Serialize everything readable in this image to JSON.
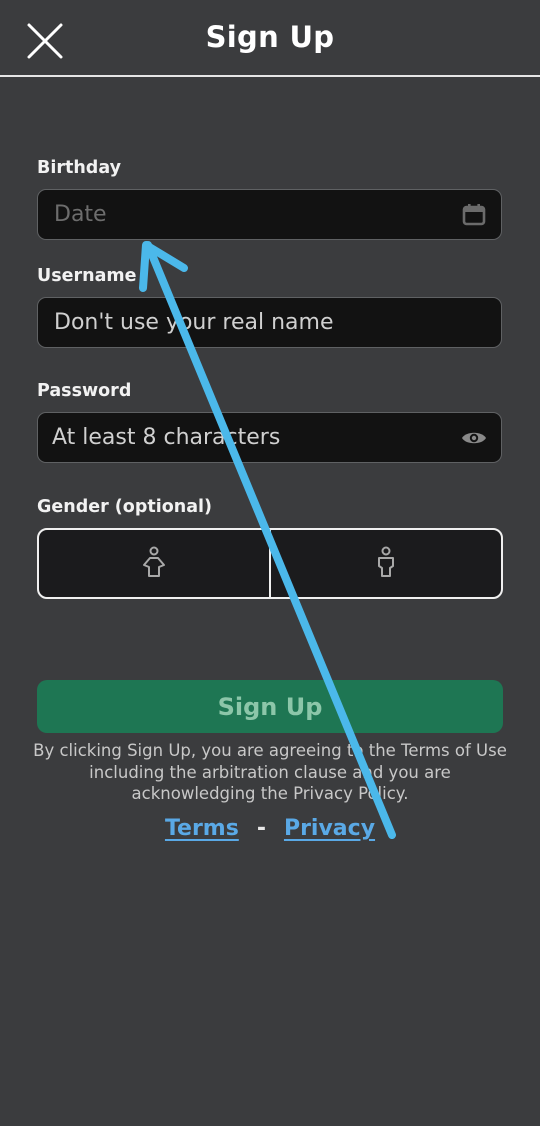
{
  "header": {
    "title": "Sign Up",
    "close_icon": "close-icon"
  },
  "form": {
    "birthday": {
      "label": "Birthday",
      "placeholder": "Date",
      "icon": "calendar-icon"
    },
    "username": {
      "label": "Username",
      "placeholder": "Don't use your real name"
    },
    "password": {
      "label": "Password",
      "placeholder": "At least 8 characters",
      "icon": "eye-icon"
    },
    "gender": {
      "label": "Gender (optional)",
      "options": [
        {
          "name": "female",
          "icon": "female-icon"
        },
        {
          "name": "male",
          "icon": "male-icon"
        }
      ]
    }
  },
  "signup_button": {
    "label": "Sign Up",
    "color": "#1e7653"
  },
  "legal": {
    "text": "By clicking Sign Up, you are agreeing to the Terms of Use including the arbitration clause and you are acknowledging the Privacy Policy."
  },
  "links": {
    "terms": "Terms",
    "separator": "-",
    "privacy": "Privacy",
    "color": "#5aa9e6"
  },
  "annotation": {
    "type": "arrow",
    "color": "#4bb8ea",
    "points_to": "birthday-field"
  }
}
